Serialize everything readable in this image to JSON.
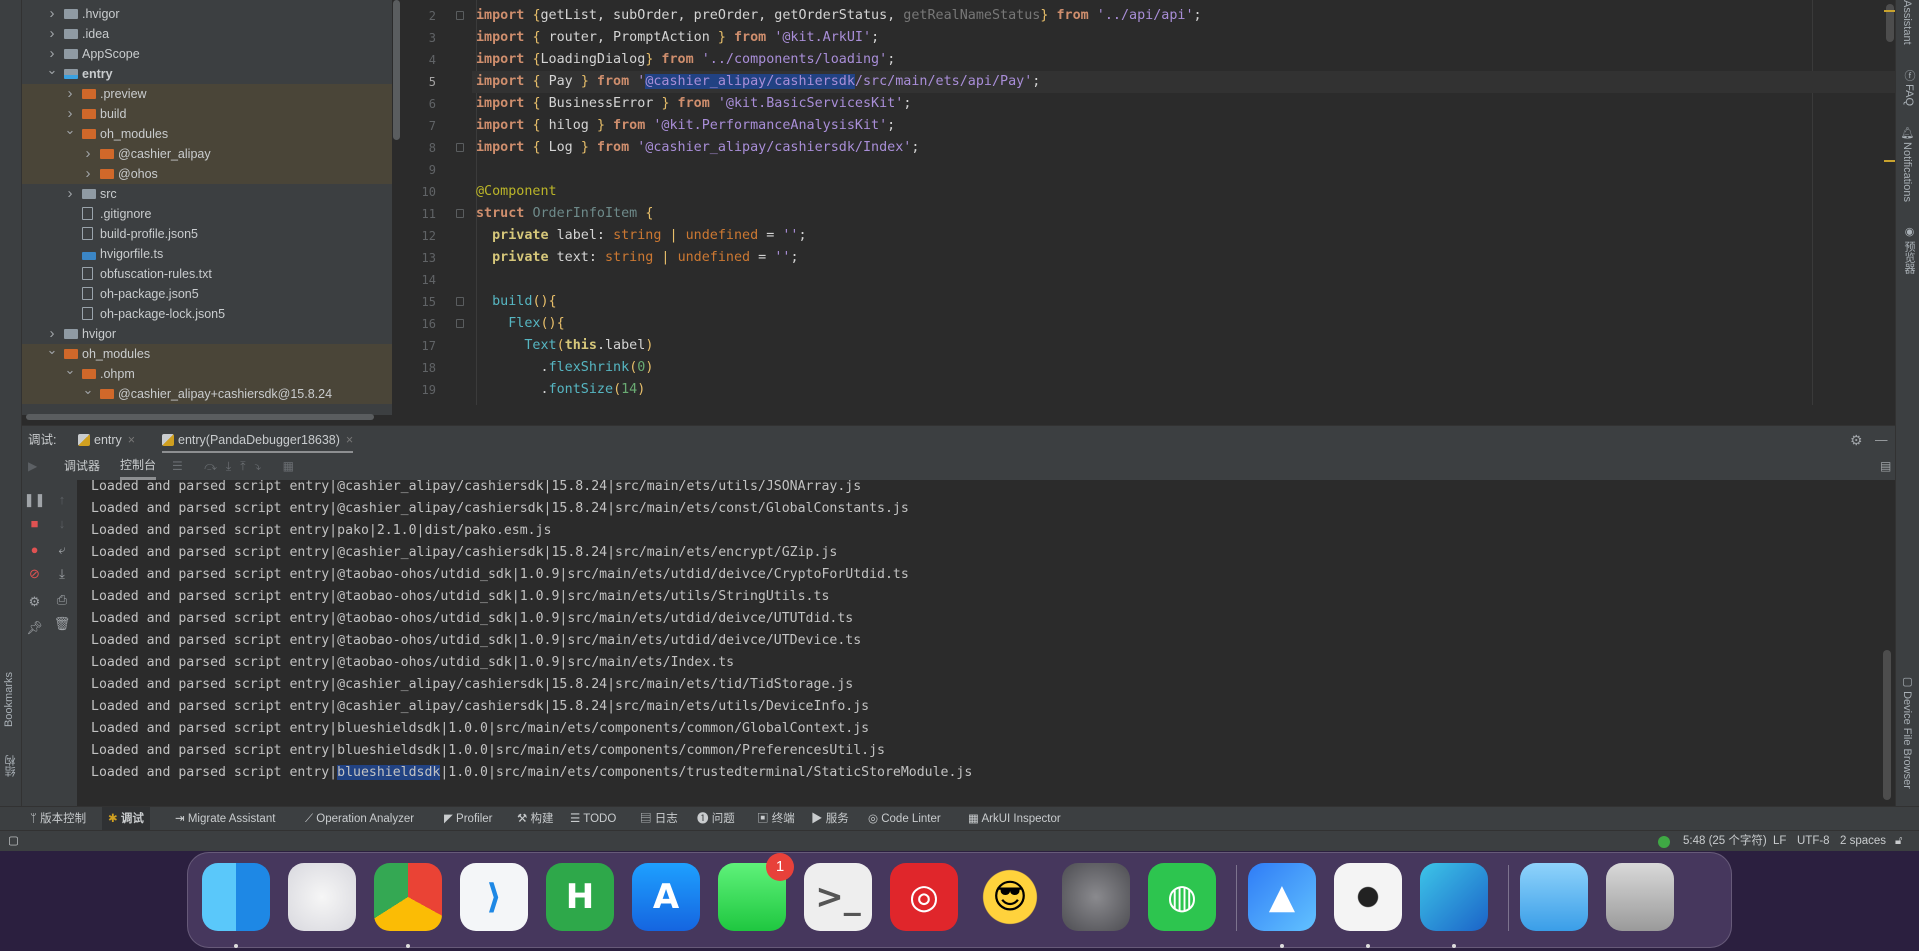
{
  "project_tree": {
    "items": [
      {
        "label": ".hvigor",
        "level": 0,
        "type": "folder",
        "color": "gray",
        "expanded": false
      },
      {
        "label": ".idea",
        "level": 0,
        "type": "folder",
        "color": "gray",
        "expanded": false
      },
      {
        "label": "AppScope",
        "level": 0,
        "type": "folder",
        "color": "gray",
        "expanded": false
      },
      {
        "label": "entry",
        "level": 0,
        "type": "module",
        "color": "gray",
        "expanded": true,
        "bold": true
      },
      {
        "label": ".preview",
        "level": 1,
        "type": "folder",
        "color": "orange",
        "expanded": false,
        "highlight": true
      },
      {
        "label": "build",
        "level": 1,
        "type": "folder",
        "color": "orange",
        "expanded": false,
        "highlight": true
      },
      {
        "label": "oh_modules",
        "level": 1,
        "type": "folder",
        "color": "orange",
        "expanded": true,
        "highlight": true
      },
      {
        "label": "@cashier_alipay",
        "level": 2,
        "type": "folder",
        "color": "orange",
        "expanded": false,
        "highlight": true
      },
      {
        "label": "@ohos",
        "level": 2,
        "type": "folder",
        "color": "orange",
        "expanded": false,
        "highlight": true
      },
      {
        "label": "src",
        "level": 1,
        "type": "folder",
        "color": "gray",
        "expanded": false
      },
      {
        "label": ".gitignore",
        "level": 1,
        "type": "file"
      },
      {
        "label": "build-profile.json5",
        "level": 1,
        "type": "file"
      },
      {
        "label": "hvigorfile.ts",
        "level": 1,
        "type": "ts"
      },
      {
        "label": "obfuscation-rules.txt",
        "level": 1,
        "type": "file"
      },
      {
        "label": "oh-package.json5",
        "level": 1,
        "type": "file"
      },
      {
        "label": "oh-package-lock.json5",
        "level": 1,
        "type": "file"
      },
      {
        "label": "hvigor",
        "level": 0,
        "type": "folder",
        "color": "gray",
        "expanded": false
      },
      {
        "label": "oh_modules",
        "level": 0,
        "type": "folder",
        "color": "orange",
        "expanded": true,
        "highlight": true
      },
      {
        "label": ".ohpm",
        "level": 1,
        "type": "folder",
        "color": "orange",
        "expanded": true,
        "highlight": true
      },
      {
        "label": "@cashier_alipay+cashiersdk@15.8.24",
        "level": 2,
        "type": "folder",
        "color": "orange",
        "expanded": true,
        "highlight": true
      }
    ]
  },
  "editor": {
    "current_line": 5,
    "lines": [
      {
        "n": "2",
        "tokens": [
          [
            "kw",
            "import "
          ],
          [
            "br",
            "{"
          ],
          [
            "",
            "getList, subOrder, preOrder, getOrderStatus, "
          ],
          [
            "dim",
            "getRealNameStatus"
          ],
          [
            "br",
            "}"
          ],
          [
            "kw",
            " from "
          ],
          [
            "str",
            "'../api/api'"
          ],
          [
            "",
            ";"
          ]
        ]
      },
      {
        "n": "3",
        "tokens": [
          [
            "kw",
            "import "
          ],
          [
            "br",
            "{ "
          ],
          [
            "",
            "router, PromptAction "
          ],
          [
            "br",
            "}"
          ],
          [
            "kw",
            " from "
          ],
          [
            "str",
            "'@kit.ArkUI'"
          ],
          [
            "",
            ";"
          ]
        ]
      },
      {
        "n": "4",
        "tokens": [
          [
            "kw",
            "import "
          ],
          [
            "br",
            "{"
          ],
          [
            "",
            "LoadingDialog"
          ],
          [
            "br",
            "}"
          ],
          [
            "kw",
            " from "
          ],
          [
            "str",
            "'../components/loading'"
          ],
          [
            "",
            ";"
          ]
        ]
      },
      {
        "n": "5",
        "tokens": [
          [
            "kw",
            "import "
          ],
          [
            "br",
            "{ "
          ],
          [
            "",
            "Pay "
          ],
          [
            "br",
            "}"
          ],
          [
            "kw",
            " from "
          ],
          [
            "str",
            "'"
          ],
          [
            "str sel",
            "@cashier_alipay/cashiersdk"
          ],
          [
            "str",
            "/src/main/ets/api/Pay'"
          ],
          [
            "",
            ";"
          ]
        ]
      },
      {
        "n": "6",
        "tokens": [
          [
            "kw",
            "import "
          ],
          [
            "br",
            "{ "
          ],
          [
            "",
            "BusinessError "
          ],
          [
            "br",
            "}"
          ],
          [
            "kw",
            " from "
          ],
          [
            "str",
            "'@kit.BasicServicesKit'"
          ],
          [
            "",
            ";"
          ]
        ]
      },
      {
        "n": "7",
        "tokens": [
          [
            "kw",
            "import "
          ],
          [
            "br",
            "{ "
          ],
          [
            "",
            "hilog "
          ],
          [
            "br",
            "}"
          ],
          [
            "kw",
            " from "
          ],
          [
            "str",
            "'@kit.PerformanceAnalysisKit'"
          ],
          [
            "",
            ";"
          ]
        ]
      },
      {
        "n": "8",
        "tokens": [
          [
            "kw",
            "import "
          ],
          [
            "br",
            "{ "
          ],
          [
            "",
            "Log "
          ],
          [
            "br",
            "}"
          ],
          [
            "kw",
            " from "
          ],
          [
            "str",
            "'@cashier_alipay/cashiersdk/Index'"
          ],
          [
            "",
            ";"
          ]
        ]
      },
      {
        "n": "9",
        "tokens": []
      },
      {
        "n": "10",
        "tokens": [
          [
            "ann",
            "@Component"
          ]
        ]
      },
      {
        "n": "11",
        "tokens": [
          [
            "kw",
            "struct "
          ],
          [
            "cls",
            "OrderInfoItem "
          ],
          [
            "br",
            "{"
          ]
        ]
      },
      {
        "n": "12",
        "tokens": [
          [
            "",
            "  "
          ],
          [
            "pv",
            "private "
          ],
          [
            "",
            "label: "
          ],
          [
            "typ",
            "string"
          ],
          [
            "br",
            " | "
          ],
          [
            "typ",
            "undefined"
          ],
          [
            "",
            " = "
          ],
          [
            "str",
            "''"
          ],
          [
            "",
            ";"
          ]
        ]
      },
      {
        "n": "13",
        "tokens": [
          [
            "",
            "  "
          ],
          [
            "pv",
            "private "
          ],
          [
            "",
            "text: "
          ],
          [
            "typ",
            "string"
          ],
          [
            "br",
            " | "
          ],
          [
            "typ",
            "undefined"
          ],
          [
            "",
            " = "
          ],
          [
            "str",
            "''"
          ],
          [
            "",
            ";"
          ]
        ]
      },
      {
        "n": "14",
        "tokens": []
      },
      {
        "n": "15",
        "tokens": [
          [
            "",
            "  "
          ],
          [
            "fn",
            "build"
          ],
          [
            "br",
            "(){"
          ]
        ]
      },
      {
        "n": "16",
        "tokens": [
          [
            "",
            "    "
          ],
          [
            "fn",
            "Flex"
          ],
          [
            "br",
            "(){"
          ]
        ]
      },
      {
        "n": "17",
        "tokens": [
          [
            "",
            "      "
          ],
          [
            "fn",
            "Text"
          ],
          [
            "br",
            "("
          ],
          [
            "pv",
            "this"
          ],
          [
            "",
            ".label"
          ],
          [
            "br",
            ")"
          ]
        ]
      },
      {
        "n": "18",
        "tokens": [
          [
            "",
            "        ."
          ],
          [
            "fn",
            "flexShrink"
          ],
          [
            "br",
            "("
          ],
          [
            "num",
            "0"
          ],
          [
            "br",
            ")"
          ]
        ]
      },
      {
        "n": "19",
        "tokens": [
          [
            "",
            "        ."
          ],
          [
            "fn",
            "fontSize"
          ],
          [
            "br",
            "("
          ],
          [
            "num",
            "14"
          ],
          [
            "br",
            ")"
          ]
        ]
      }
    ]
  },
  "right_strip": [
    "Assistant",
    "FAQ",
    "Notifications",
    "预览器",
    "Device File Browser"
  ],
  "left_strip": [
    "Bookmarks",
    "结构"
  ],
  "debug_panel": {
    "label": "调试:",
    "tabs": [
      {
        "label": "entry",
        "active": false
      },
      {
        "label": "entry(PandaDebugger18638)",
        "active": true
      }
    ],
    "subtabs": [
      {
        "label": "调试器",
        "active": false
      },
      {
        "label": "控制台",
        "active": true
      }
    ],
    "console_lines": [
      "Loaded and parsed script entry|@cashier_alipay/cashiersdk|15.8.24|src/main/ets/utils/JSONArray.js",
      "Loaded and parsed script entry|@cashier_alipay/cashiersdk|15.8.24|src/main/ets/const/GlobalConstants.js",
      "Loaded and parsed script entry|pako|2.1.0|dist/pako.esm.js",
      "Loaded and parsed script entry|@cashier_alipay/cashiersdk|15.8.24|src/main/ets/encrypt/GZip.js",
      "Loaded and parsed script entry|@taobao-ohos/utdid_sdk|1.0.9|src/main/ets/utdid/deivce/CryptoForUtdid.ts",
      "Loaded and parsed script entry|@taobao-ohos/utdid_sdk|1.0.9|src/main/ets/utils/StringUtils.ts",
      "Loaded and parsed script entry|@taobao-ohos/utdid_sdk|1.0.9|src/main/ets/utdid/deivce/UTUTdid.ts",
      "Loaded and parsed script entry|@taobao-ohos/utdid_sdk|1.0.9|src/main/ets/utdid/deivce/UTDevice.ts",
      "Loaded and parsed script entry|@taobao-ohos/utdid_sdk|1.0.9|src/main/ets/Index.ts",
      "Loaded and parsed script entry|@cashier_alipay/cashiersdk|15.8.24|src/main/ets/tid/TidStorage.js",
      "Loaded and parsed script entry|@cashier_alipay/cashiersdk|15.8.24|src/main/ets/utils/DeviceInfo.js",
      "Loaded and parsed script entry|blueshieldsdk|1.0.0|src/main/ets/components/common/GlobalContext.js",
      "Loaded and parsed script entry|blueshieldsdk|1.0.0|src/main/ets/components/common/PreferencesUtil.js"
    ],
    "last_line": {
      "prefix": "Loaded and parsed script entry|",
      "selected": "blueshieldsdk",
      "suffix": "|1.0.0|src/main/ets/components/trustedterminal/StaticStoreModule.js"
    }
  },
  "bottom_toolbar": [
    {
      "label": "版本控制",
      "icon": "vcs-icon"
    },
    {
      "label": "调试",
      "icon": "bug-icon",
      "active": true
    },
    {
      "label": "Migrate Assistant",
      "icon": "migrate-icon"
    },
    {
      "label": "Operation Analyzer",
      "icon": "chart-icon"
    },
    {
      "label": "Profiler",
      "icon": "profiler-icon"
    },
    {
      "label": "构建",
      "icon": "hammer-icon"
    },
    {
      "label": "TODO",
      "icon": "list-icon"
    },
    {
      "label": "日志",
      "icon": "log-icon"
    },
    {
      "label": "问题",
      "icon": "problem-icon"
    },
    {
      "label": "终端",
      "icon": "terminal-icon"
    },
    {
      "label": "服务",
      "icon": "services-icon"
    },
    {
      "label": "Code Linter",
      "icon": "linter-icon"
    },
    {
      "label": "ArkUI Inspector",
      "icon": "inspector-icon"
    }
  ],
  "status_bar": {
    "position": "5:48 (25 个字符)",
    "line_ending": "LF",
    "encoding": "UTF-8",
    "indent": "2 spaces",
    "status_color": "#3fa844"
  },
  "dock": {
    "apps": [
      {
        "name": "finder",
        "running": true
      },
      {
        "name": "launchpad",
        "running": false
      },
      {
        "name": "chrome",
        "running": true
      },
      {
        "name": "vscode",
        "running": false
      },
      {
        "name": "hbuilder",
        "running": false
      },
      {
        "name": "app-store",
        "running": false
      },
      {
        "name": "messages",
        "running": false,
        "badge": "1"
      },
      {
        "name": "chat-terminal",
        "running": false
      },
      {
        "name": "netease-music",
        "running": false
      },
      {
        "name": "qq",
        "running": false
      },
      {
        "name": "system-settings",
        "running": false
      },
      {
        "name": "wechat",
        "running": false
      },
      {
        "name": "deveco-studio",
        "running": true
      },
      {
        "name": "camera",
        "running": true
      },
      {
        "name": "app-star",
        "running": true
      },
      {
        "name": "downloads-folder",
        "running": false
      },
      {
        "name": "trash",
        "running": false
      }
    ]
  }
}
